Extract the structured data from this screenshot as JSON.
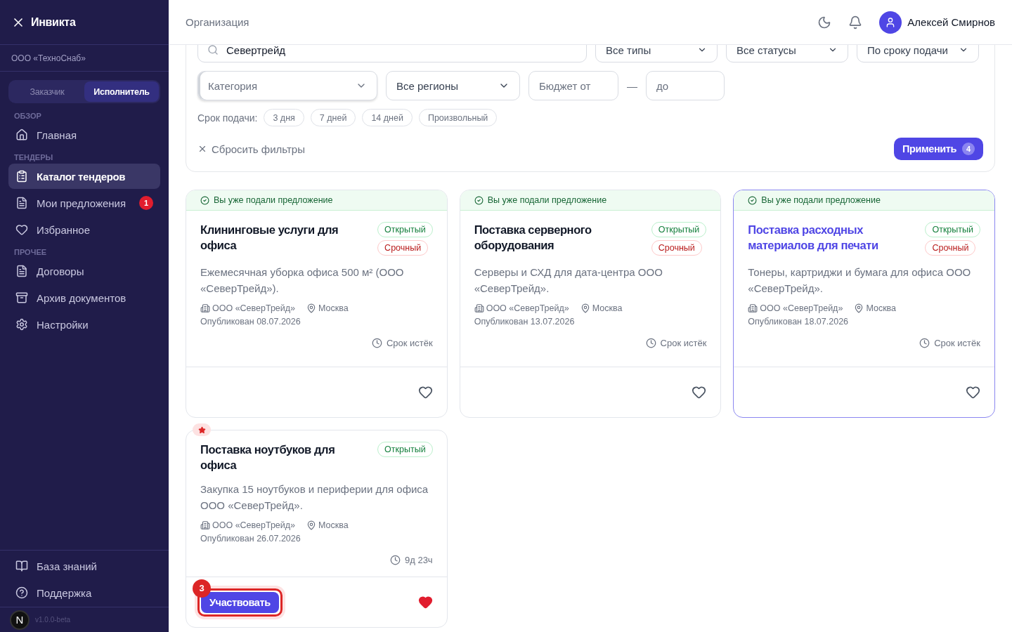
{
  "sidebar": {
    "brand": "Инвикта",
    "org": "ООО «ТехноСнаб»",
    "roles": [
      {
        "label": "Заказчик",
        "selected": false
      },
      {
        "label": "Исполнитель",
        "selected": true
      }
    ],
    "sections": [
      {
        "title": "ОБЗОР",
        "items": [
          {
            "label": "Главная",
            "selected": false
          }
        ]
      },
      {
        "title": "ТЕНДЕРЫ",
        "items": [
          {
            "label": "Каталог тендеров",
            "selected": true
          },
          {
            "label": "Мои предложения",
            "selected": false,
            "badge": "1"
          },
          {
            "label": "Избранное",
            "selected": false
          }
        ]
      },
      {
        "title": "ПРОЧЕЕ",
        "items": [
          {
            "label": "Договоры",
            "selected": false
          },
          {
            "label": "Архив документов",
            "selected": false
          },
          {
            "label": "Настройки",
            "selected": false
          }
        ]
      }
    ],
    "footer_items": [
      {
        "label": "База знаний"
      },
      {
        "label": "Поддержка"
      }
    ],
    "dev_badge": "N",
    "version": "v1.0.0-beta"
  },
  "header": {
    "title": "Организация",
    "user": "Алексей Смирнов"
  },
  "filters": {
    "search": {
      "value": "Севертрейд"
    },
    "selects_top": [
      "Все типы",
      "Все статусы",
      "По сроку подачи"
    ],
    "category": "Категория",
    "region": "Все регионы",
    "budget_from": {
      "placeholder": "Бюджет от"
    },
    "budget_dash": "—",
    "budget_to": {
      "placeholder": "до"
    },
    "deadline_label": "Срок подачи:",
    "deadline_chips": [
      {
        "label": "3 дня",
        "selected": false
      },
      {
        "label": "7 дней",
        "selected": false
      },
      {
        "label": "14 дней",
        "selected": false
      },
      {
        "label": "Произвольный",
        "selected": false
      }
    ],
    "reset": "Сбросить фильтры",
    "apply": "Применить",
    "apply_count": "4"
  },
  "tenders": [
    {
      "submitted_note": "Вы уже подали предложение",
      "title": "Клининговые услуги для офиса",
      "highlighted": false,
      "tags": [
        {
          "kind": "open",
          "label": "Открытый"
        },
        {
          "kind": "urgent",
          "label": "Срочный"
        }
      ],
      "description": "Ежемесячная уборка офиса 500 м² (ООО «СеверТрейд»).",
      "customer": "ООО «СеверТрейд»",
      "city": "Москва",
      "published": "Опубликован 08.07.2026",
      "deadline": "Срок истёк",
      "favorite": false
    },
    {
      "submitted_note": "Вы уже подали предложение",
      "title": "Поставка серверного оборудования",
      "highlighted": false,
      "tags": [
        {
          "kind": "open",
          "label": "Открытый"
        },
        {
          "kind": "urgent",
          "label": "Срочный"
        }
      ],
      "description": "Серверы и СХД для дата-центра ООО «СеверТрейд».",
      "customer": "ООО «СеверТрейд»",
      "city": "Москва",
      "published": "Опубликован 13.07.2026",
      "deadline": "Срок истёк",
      "favorite": false
    },
    {
      "submitted_note": "Вы уже подали предложение",
      "title": "Поставка расходных материалов для печати",
      "highlighted": true,
      "tags": [
        {
          "kind": "open",
          "label": "Открытый"
        },
        {
          "kind": "urgent",
          "label": "Срочный"
        }
      ],
      "description": "Тонеры, картриджи и бумага для офиса ООО «СеверТрейд».",
      "customer": "ООО «СеверТрейд»",
      "city": "Москва",
      "published": "Опубликован 18.07.2026",
      "deadline": "Срок истёк",
      "favorite": false
    },
    {
      "title": "Поставка ноутбуков для офиса",
      "highlighted": false,
      "tags": [
        {
          "kind": "open",
          "label": "Открытый"
        }
      ],
      "description": "Закупка 15 ноутбуков и периферии для офиса ООО «СеверТрейд».",
      "customer": "ООО «СеверТрейд»",
      "city": "Москва",
      "published": "Опубликован 26.07.2026",
      "deadline": "9д 23ч",
      "favorite": true,
      "action": {
        "label": "Участвовать",
        "tour_step": "3"
      }
    }
  ]
}
